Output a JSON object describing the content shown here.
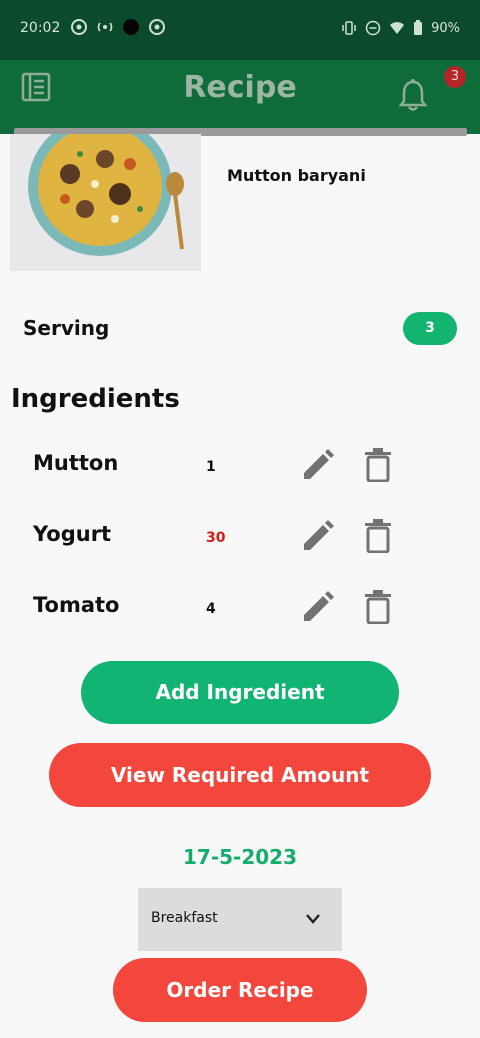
{
  "status_bar": {
    "time": "20:02",
    "battery": "90%",
    "background_color": "#0c4a2c"
  },
  "app_bar": {
    "title": "Recipe",
    "notification_count": "3",
    "background_color": "#0f6b3a",
    "icons": [
      "menu-icon",
      "bell-icon"
    ]
  },
  "recipe": {
    "name": "Mutton baryani"
  },
  "serving": {
    "label": "Serving",
    "value": "3"
  },
  "ingredients": {
    "title": "Ingredients",
    "items": [
      {
        "name": "Mutton",
        "qty": "1",
        "qty_color": "#111111"
      },
      {
        "name": "Yogurt",
        "qty": "30",
        "qty_color": "#d81b1b"
      },
      {
        "name": "Tomato",
        "qty": "4",
        "qty_color": "#111111"
      }
    ],
    "row_icons": [
      "edit-icon",
      "delete-icon"
    ]
  },
  "actions": {
    "add_ingredient": "Add Ingredient",
    "view_required": "View Required Amount",
    "order_recipe": "Order Recipe"
  },
  "date": "17-5-2023",
  "meal_select": {
    "value": "Breakfast"
  },
  "colors": {
    "accent_green": "#12b474",
    "accent_red": "#f3473d"
  }
}
